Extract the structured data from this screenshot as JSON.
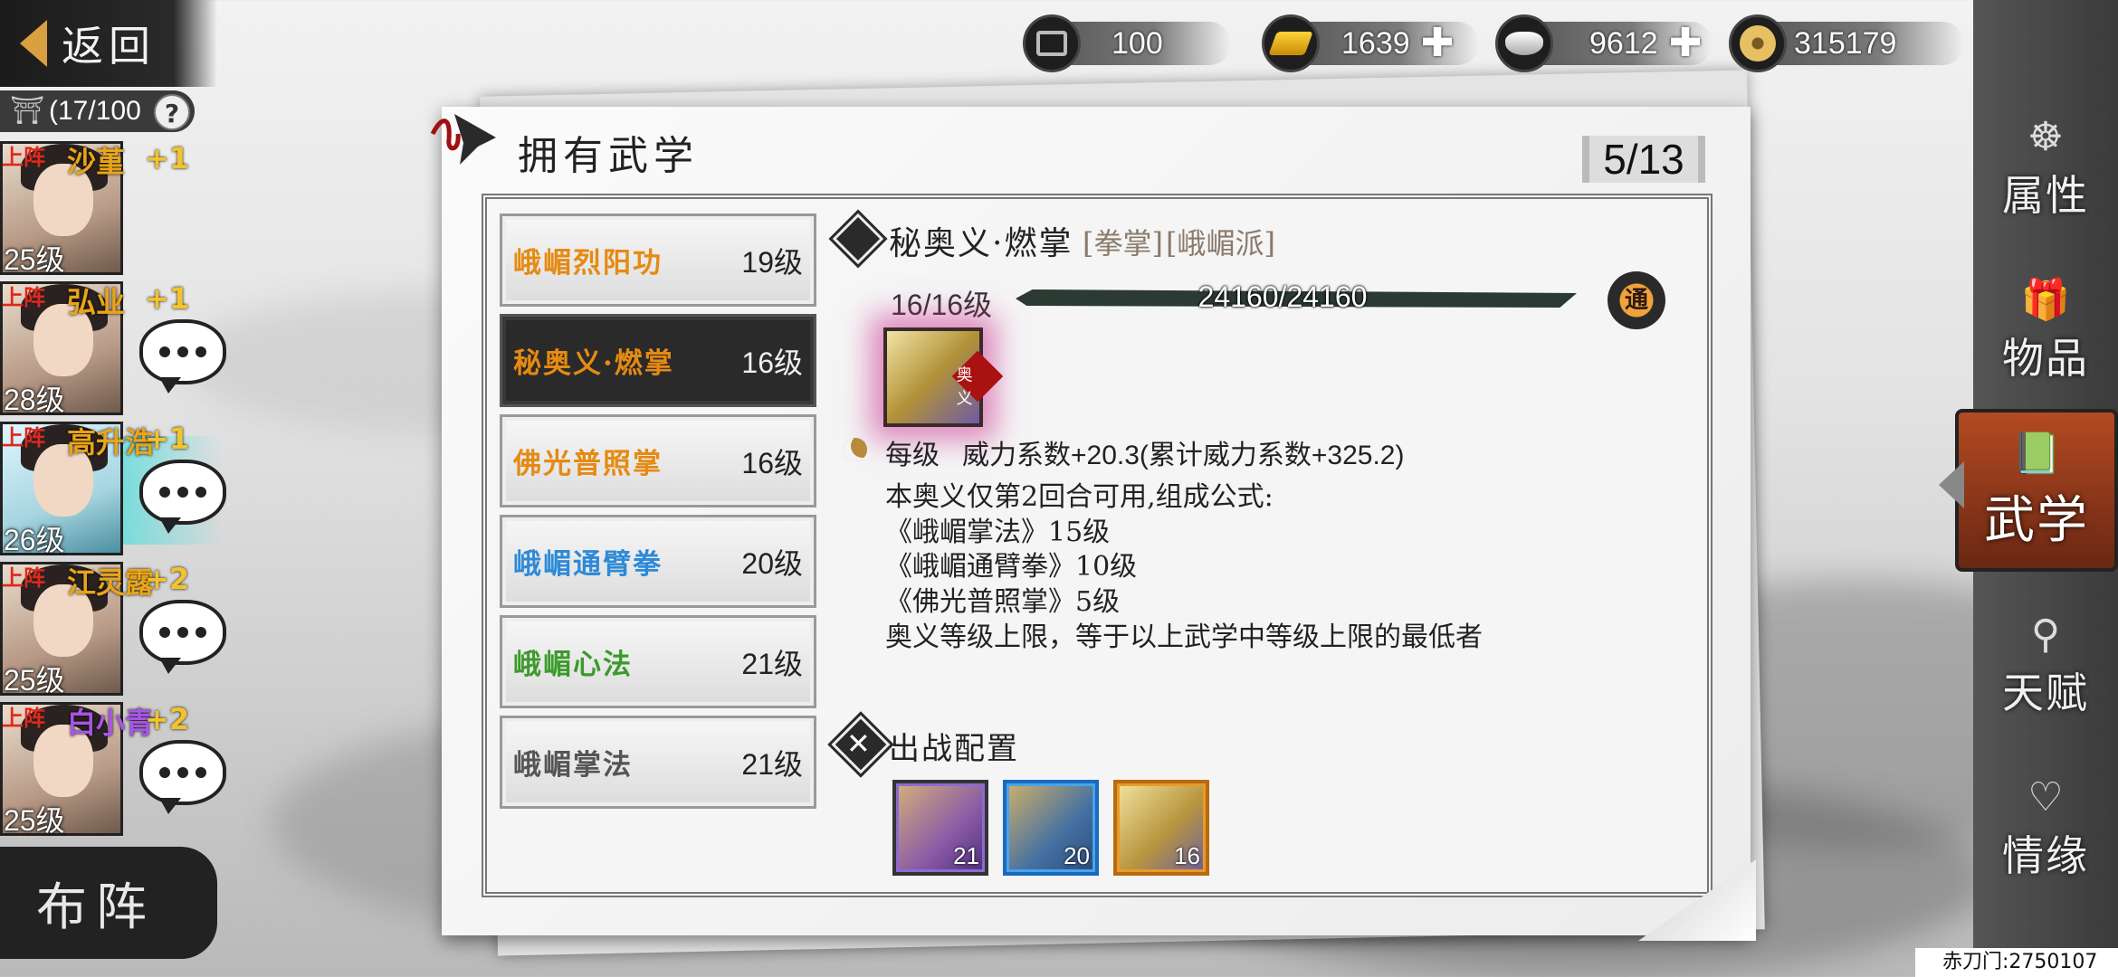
{
  "back": {
    "label": "返回"
  },
  "capacity": {
    "text": "(17/100",
    "help": "?"
  },
  "currencies": [
    {
      "icon": "cart-icon",
      "value": "100",
      "plus": false
    },
    {
      "icon": "gold-ingot-icon",
      "value": "1639",
      "plus": true
    },
    {
      "icon": "silver-ingot-icon",
      "value": "9612",
      "plus": true
    },
    {
      "icon": "copper-coin-icon",
      "value": "315179",
      "plus": false
    }
  ],
  "characters": [
    {
      "tag": "上阵",
      "name": "沙堇",
      "plus": "+1",
      "level": "25级",
      "chat": false
    },
    {
      "tag": "上阵",
      "name": "弘业",
      "plus": "+1",
      "level": "28级",
      "chat": true
    },
    {
      "tag": "上阵",
      "name": "高升浩",
      "plus": "+1",
      "level": "26级",
      "chat": true
    },
    {
      "tag": "上阵",
      "name": "江灵露",
      "plus": "+2",
      "level": "25级",
      "chat": true
    },
    {
      "tag": "上阵",
      "name": "白小青",
      "plus": "+2",
      "level": "25级",
      "chat": true
    }
  ],
  "formation": {
    "label": "布阵"
  },
  "nav": [
    {
      "label": "属性",
      "icon": "attribute-icon"
    },
    {
      "label": "物品",
      "icon": "item-icon"
    },
    {
      "label": "武学",
      "icon": "martial-book-icon"
    },
    {
      "label": "天赋",
      "icon": "talent-icon"
    },
    {
      "label": "情缘",
      "icon": "bond-icon"
    }
  ],
  "panel": {
    "title": "拥有武学",
    "page": "5/13"
  },
  "skills": [
    {
      "name": "峨嵋烈阳功",
      "level": "19级",
      "color": "#e58a12"
    },
    {
      "name": "秘奥义·燃掌",
      "level": "16级",
      "color": "#e58a12"
    },
    {
      "name": "佛光普照掌",
      "level": "16级",
      "color": "#e58a12"
    },
    {
      "name": "峨嵋通臂拳",
      "level": "20级",
      "color": "#2e8ad8"
    },
    {
      "name": "峨嵋心法",
      "level": "21级",
      "color": "#3c9a2c"
    },
    {
      "name": "峨嵋掌法",
      "level": "21级",
      "color": "#555555"
    }
  ],
  "detail": {
    "title": "秘奥义·燃掌",
    "tag1": "[拳掌]",
    "tag2": "[峨嵋派]",
    "level": "16/16级",
    "exp": "24160/24160",
    "exp_fraction": 1.0,
    "badge": "通",
    "icon_badge": "奥义",
    "lines": [
      "每级   威力系数+20.3(累计威力系数+325.2)",
      "本奥义仅第2回合可用,组成公式:",
      "《峨嵋掌法》15级",
      "《峨嵋通臂拳》10级",
      "《佛光普照掌》5级",
      "奥义等级上限，等于以上武学中等级上限的最低者"
    ]
  },
  "config": {
    "title": "出战配置",
    "slots": [
      "21",
      "20",
      "16"
    ]
  },
  "server": {
    "text": "赤刀门:2750107"
  }
}
